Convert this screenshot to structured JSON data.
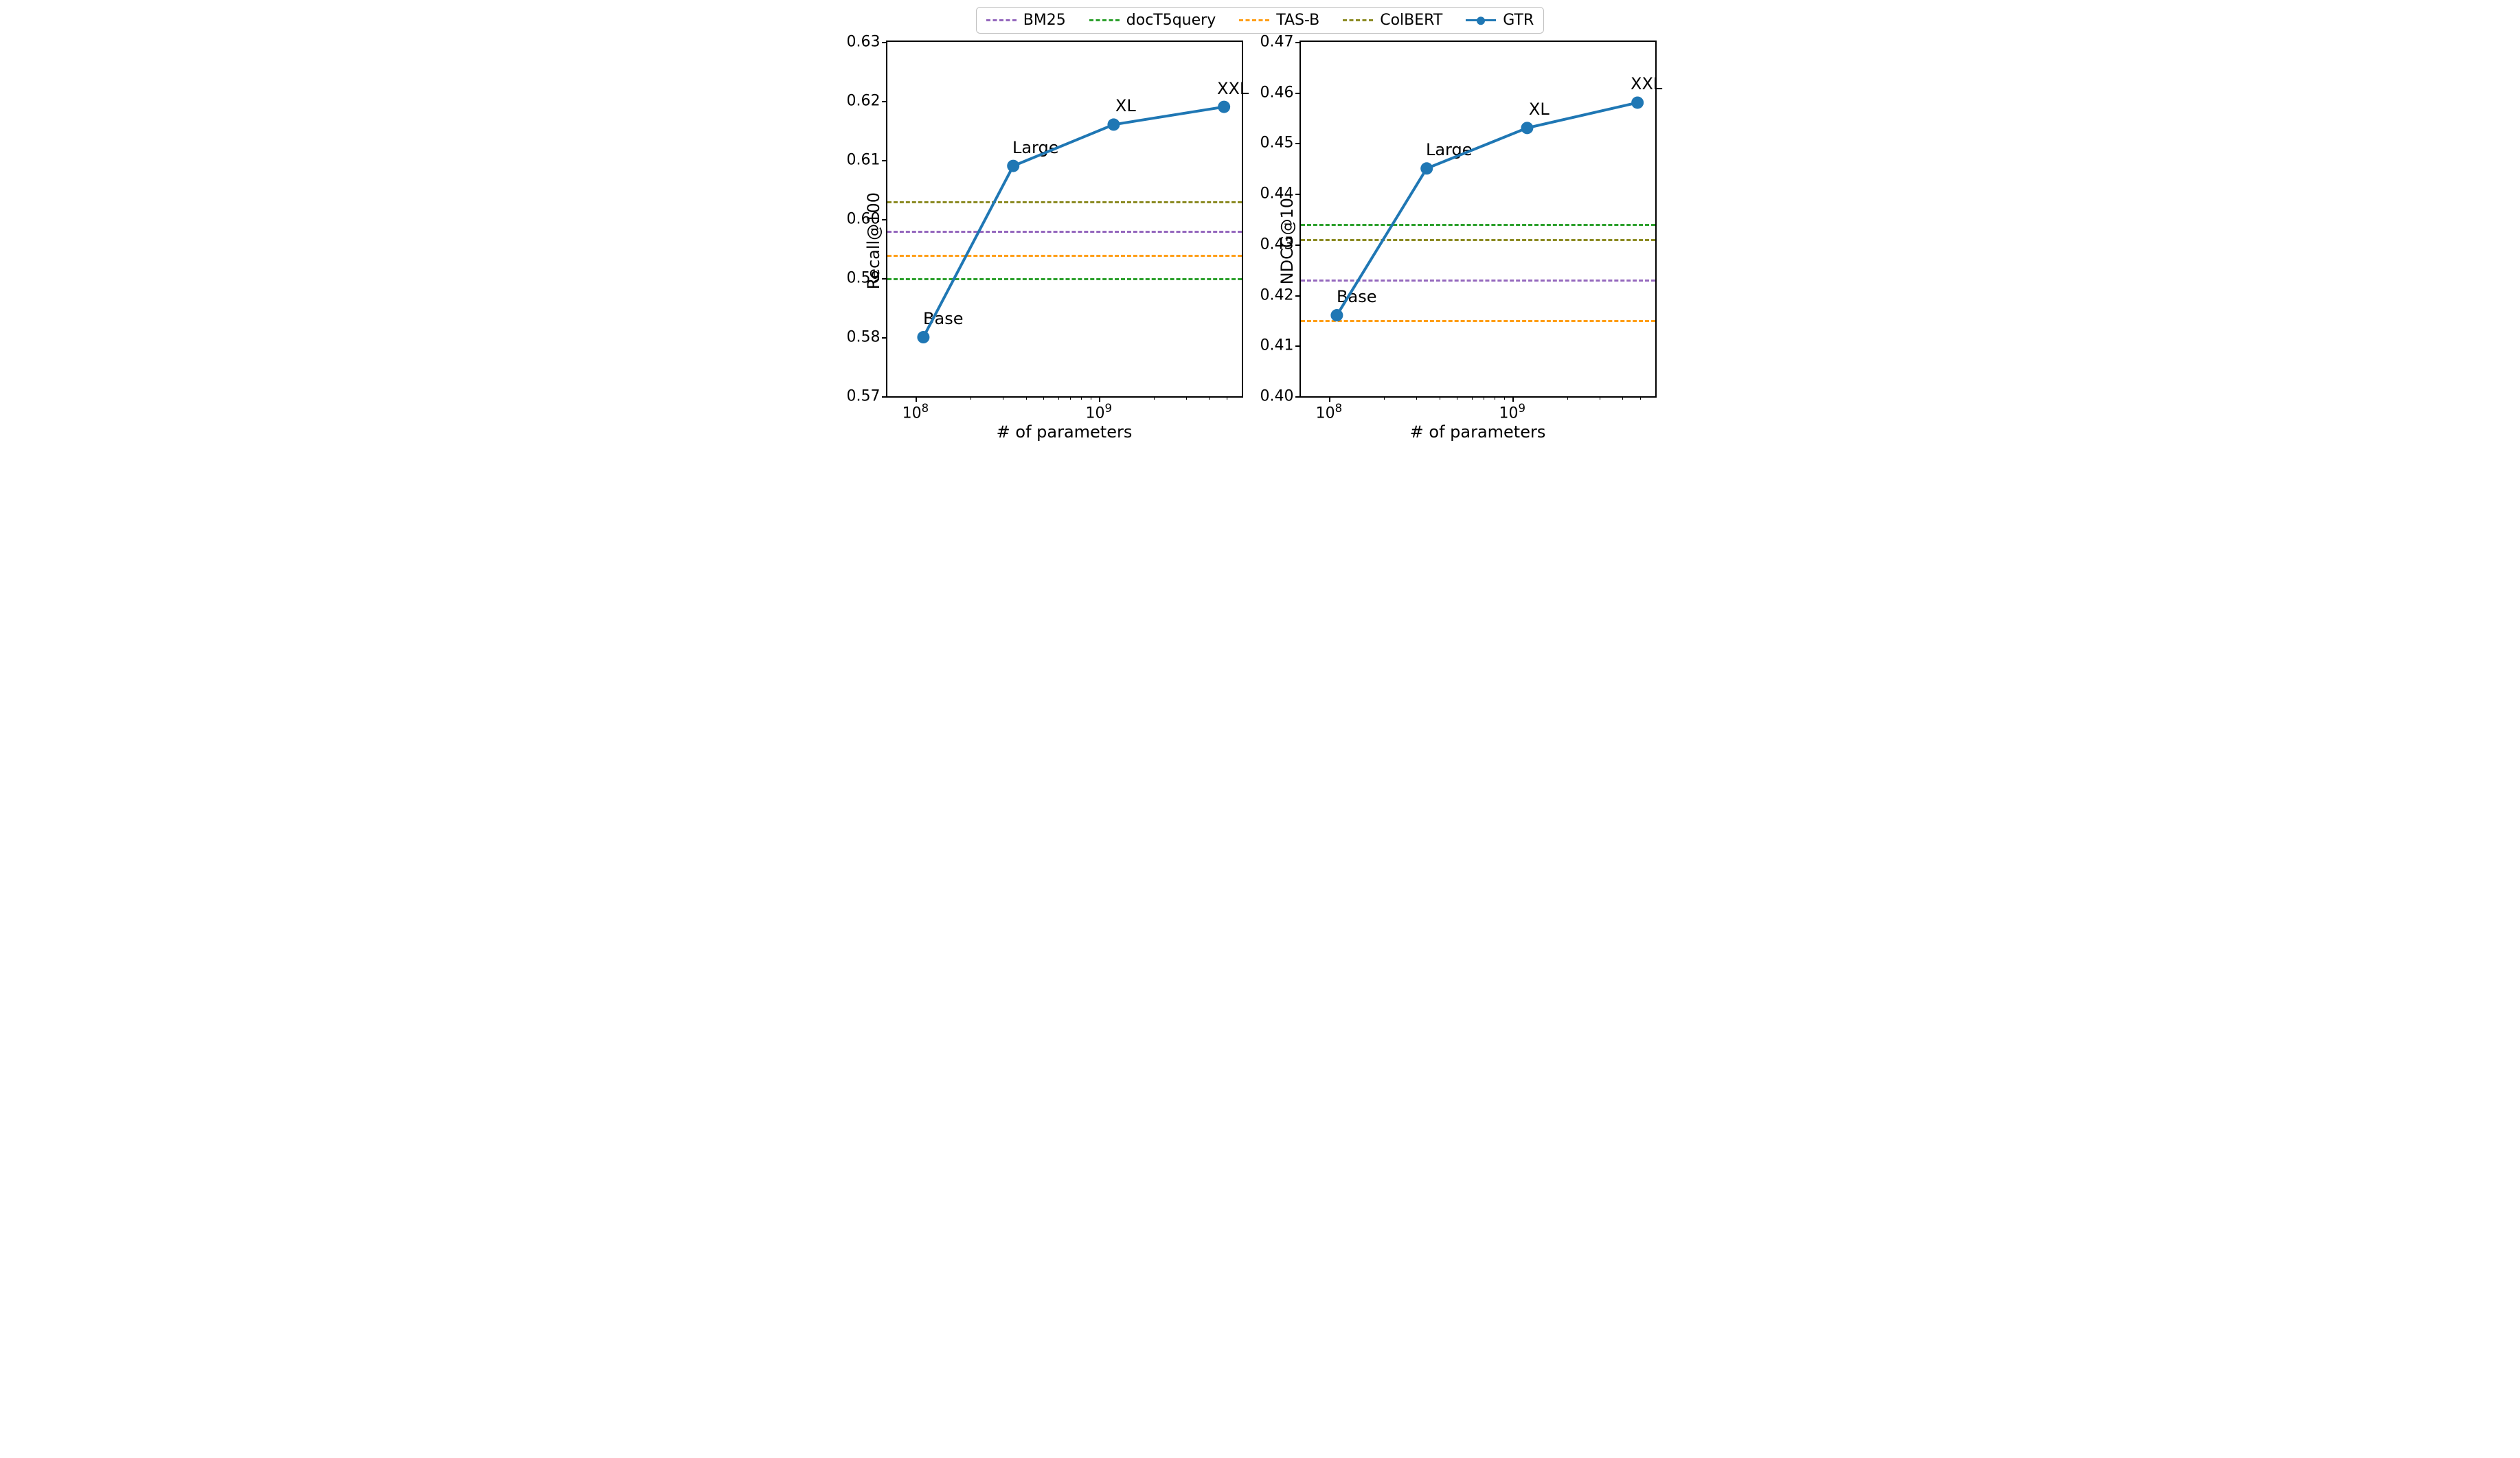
{
  "legend": [
    {
      "label": "BM25",
      "color": "#9467bd",
      "style": "dash"
    },
    {
      "label": "docT5query",
      "color": "#2ca02c",
      "style": "dash"
    },
    {
      "label": "TAS-B",
      "color": "#ff9e16",
      "style": "dash"
    },
    {
      "label": "ColBERT",
      "color": "#8c8b23",
      "style": "dash"
    },
    {
      "label": "GTR",
      "color": "#1f77b4",
      "style": "line"
    }
  ],
  "chart_data": [
    {
      "type": "line",
      "title": "",
      "xlabel": "# of parameters",
      "ylabel": "Recall@100",
      "x_scale": "log",
      "xlim": [
        70000000.0,
        6000000000.0
      ],
      "ylim": [
        0.57,
        0.63
      ],
      "yticks": [
        0.57,
        0.58,
        0.59,
        0.6,
        0.61,
        0.62,
        0.63
      ],
      "xticks_major": [
        100000000.0,
        1000000000.0
      ],
      "xticks_minor": [
        200000000.0,
        300000000.0,
        400000000.0,
        500000000.0,
        600000000.0,
        700000000.0,
        800000000.0,
        900000000.0,
        2000000000.0,
        3000000000.0,
        4000000000.0,
        5000000000.0
      ],
      "baselines": [
        {
          "name": "BM25",
          "value": 0.598,
          "color": "#9467bd"
        },
        {
          "name": "docT5query",
          "value": 0.59,
          "color": "#2ca02c"
        },
        {
          "name": "TAS-B",
          "value": 0.594,
          "color": "#ff9e16"
        },
        {
          "name": "ColBERT",
          "value": 0.603,
          "color": "#8c8b23"
        }
      ],
      "series": [
        {
          "name": "GTR",
          "color": "#1f77b4",
          "points": [
            {
              "x": 110000000.0,
              "y": 0.58,
              "label": "Base"
            },
            {
              "x": 340000000.0,
              "y": 0.609,
              "label": "Large"
            },
            {
              "x": 1200000000.0,
              "y": 0.616,
              "label": "XL"
            },
            {
              "x": 4800000000.0,
              "y": 0.619,
              "label": "XXL"
            }
          ]
        }
      ]
    },
    {
      "type": "line",
      "title": "",
      "xlabel": "# of parameters",
      "ylabel": "NDCG@10",
      "x_scale": "log",
      "xlim": [
        70000000.0,
        6000000000.0
      ],
      "ylim": [
        0.4,
        0.47
      ],
      "yticks": [
        0.4,
        0.41,
        0.42,
        0.43,
        0.44,
        0.45,
        0.46,
        0.47
      ],
      "xticks_major": [
        100000000.0,
        1000000000.0
      ],
      "xticks_minor": [
        200000000.0,
        300000000.0,
        400000000.0,
        500000000.0,
        600000000.0,
        700000000.0,
        800000000.0,
        900000000.0,
        2000000000.0,
        3000000000.0,
        4000000000.0,
        5000000000.0
      ],
      "baselines": [
        {
          "name": "BM25",
          "value": 0.423,
          "color": "#9467bd"
        },
        {
          "name": "docT5query",
          "value": 0.434,
          "color": "#2ca02c"
        },
        {
          "name": "TAS-B",
          "value": 0.415,
          "color": "#ff9e16"
        },
        {
          "name": "ColBERT",
          "value": 0.431,
          "color": "#8c8b23"
        }
      ],
      "series": [
        {
          "name": "GTR",
          "color": "#1f77b4",
          "points": [
            {
              "x": 110000000.0,
              "y": 0.416,
              "label": "Base"
            },
            {
              "x": 340000000.0,
              "y": 0.445,
              "label": "Large"
            },
            {
              "x": 1200000000.0,
              "y": 0.453,
              "label": "XL"
            },
            {
              "x": 4800000000.0,
              "y": 0.458,
              "label": "XXL"
            }
          ]
        }
      ]
    }
  ]
}
